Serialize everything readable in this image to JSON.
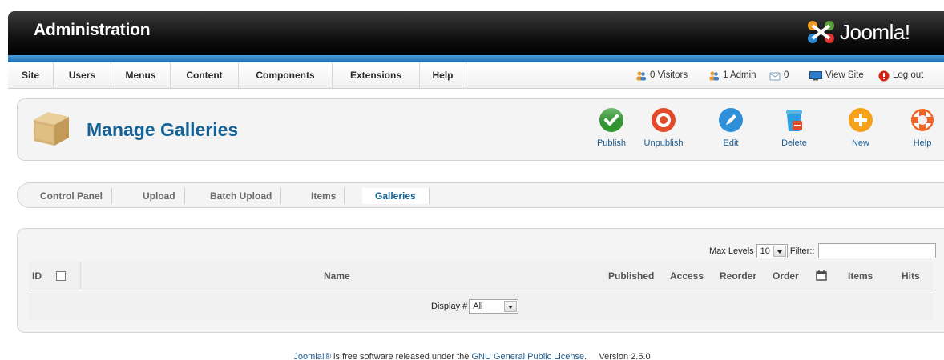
{
  "header": {
    "title": "Administration",
    "logo_text": "Joomla!"
  },
  "menu": {
    "items": [
      "Site",
      "Users",
      "Menus",
      "Content",
      "Components",
      "Extensions",
      "Help"
    ],
    "status": {
      "visitors": "0 Visitors",
      "admins": "1 Admin",
      "messages": "0",
      "view_site": "View Site",
      "logout": "Log out"
    }
  },
  "toolbar": {
    "title": "Manage Galleries",
    "buttons": [
      {
        "label": "Publish",
        "icon": "publish-icon",
        "color": "#2e9c2e"
      },
      {
        "label": "Unpublish",
        "icon": "unpublish-icon",
        "color": "#e24a2a"
      },
      {
        "label": "Edit",
        "icon": "edit-icon",
        "color": "#2f8fd8"
      },
      {
        "label": "Delete",
        "icon": "trash-icon",
        "color": "#2b9fe0"
      },
      {
        "label": "New",
        "icon": "plus-icon",
        "color": "#f5a21a"
      },
      {
        "label": "Help",
        "icon": "lifebuoy-icon",
        "color": "#f26522"
      }
    ]
  },
  "submenu": {
    "items": [
      "Control Panel",
      "Upload",
      "Batch Upload",
      "Items",
      "Galleries"
    ],
    "active": "Galleries"
  },
  "filters": {
    "max_levels_label": "Max Levels",
    "max_levels_value": "10",
    "filter_label": "Filter::",
    "filter_value": ""
  },
  "table": {
    "columns": [
      "ID",
      "Name",
      "Published",
      "Access",
      "Reorder",
      "Order",
      "Items",
      "Hits"
    ],
    "display_label": "Display #",
    "display_value": "All"
  },
  "footer": {
    "joomla_link": "Joomla!®",
    "text_mid": " is free software released under the ",
    "license_link": "GNU General Public License",
    "version": ".     Version 2.5.0"
  }
}
